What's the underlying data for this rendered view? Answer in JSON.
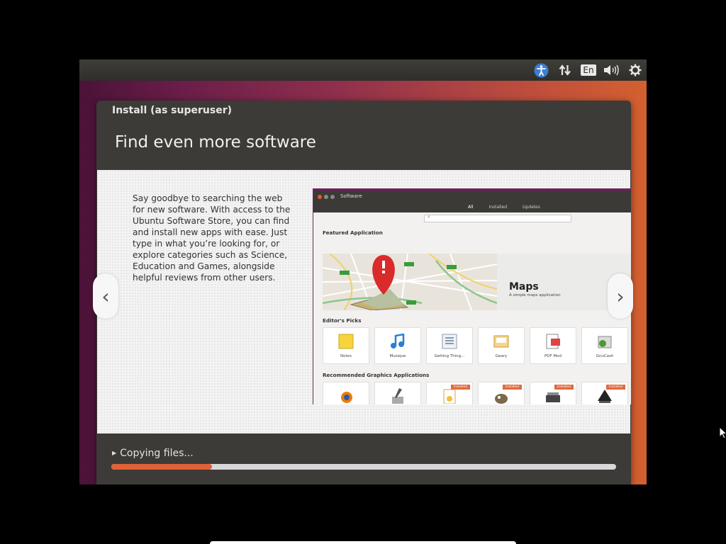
{
  "topbar": {
    "language": "En",
    "icons": [
      "accessibility-icon",
      "network-icon",
      "keyboard-language-indicator",
      "volume-icon",
      "gear-icon"
    ]
  },
  "window": {
    "title": "Install (as superuser)"
  },
  "slide": {
    "title": "Find even more software",
    "body": "Say goodbye to searching the web for new software. With access to the Ubuntu Software Store, you can find and install new apps with ease. Just type in what you’re looking for, or explore categories such as Science, Education and Games, alongside helpful reviews from other users.",
    "prev_arrow": "‹",
    "next_arrow": "›"
  },
  "software_shot": {
    "window_title": "Software",
    "tabs": [
      "All",
      "Installed",
      "Updates"
    ],
    "featured_heading": "Featured Application",
    "featured_name": "Maps",
    "featured_desc": "A simple maps application",
    "editors_heading": "Editor's Picks",
    "editors_picks": [
      "Notes",
      "Musique",
      "Getting Thing...",
      "Geary",
      "PDF Mod",
      "GnuCash"
    ],
    "recommended_heading": "Recommended Graphics Applications",
    "recommended_badges": [
      "Installed",
      "Installed",
      "Installed",
      "Installed"
    ]
  },
  "install": {
    "status": "Copying files...",
    "progress": 0.2
  },
  "colors": {
    "accent": "#e06237",
    "window_bg": "#3c3b37"
  }
}
